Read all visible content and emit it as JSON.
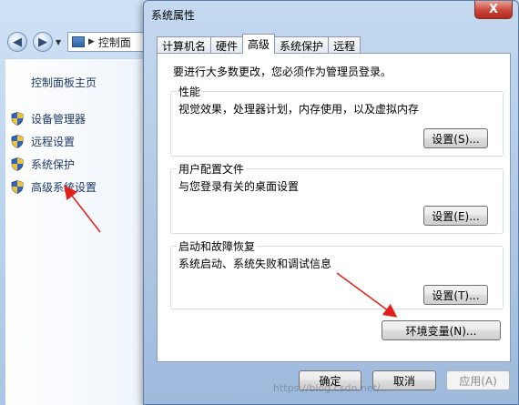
{
  "background_window": {
    "address_text": "控制面",
    "left_pane": {
      "home_link": "控制面板主页",
      "items": [
        {
          "label": "设备管理器"
        },
        {
          "label": "远程设置"
        },
        {
          "label": "系统保护"
        },
        {
          "label": "高级系统设置"
        }
      ]
    }
  },
  "dialog": {
    "title": "系统属性",
    "close_label": "X",
    "tabs": [
      {
        "label": "计算机名",
        "active": false
      },
      {
        "label": "硬件",
        "active": false
      },
      {
        "label": "高级",
        "active": true
      },
      {
        "label": "系统保护",
        "active": false
      },
      {
        "label": "远程",
        "active": false
      }
    ],
    "intro": "要进行大多数更改，您必须作为管理员登录。",
    "groups": [
      {
        "title": "性能",
        "description": "视觉效果，处理器计划，内存使用，以及虚拟内存",
        "button": "设置(S)..."
      },
      {
        "title": "用户配置文件",
        "description": "与您登录有关的桌面设置",
        "button": "设置(E)..."
      },
      {
        "title": "启动和故障恢复",
        "description": "系统启动、系统失败和调试信息",
        "button": "设置(T)..."
      }
    ],
    "env_button": "环境变量(N)...",
    "footer": {
      "ok": "确定",
      "cancel": "取消",
      "apply": "应用(A)"
    }
  },
  "watermark": "https://blog.csdn.net/..."
}
